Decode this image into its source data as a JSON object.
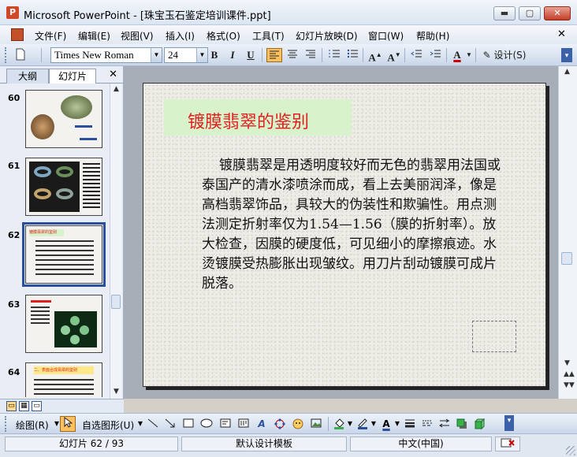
{
  "window": {
    "title": "Microsoft PowerPoint - [珠宝玉石鉴定培训课件.ppt]",
    "buttons": [
      "▬",
      "▢",
      "✕"
    ]
  },
  "menu": {
    "items": [
      "文件(F)",
      "编辑(E)",
      "视图(V)",
      "插入(I)",
      "格式(O)",
      "工具(T)",
      "幻灯片放映(D)",
      "窗口(W)",
      "帮助(H)"
    ],
    "close": "✕"
  },
  "toolbar": {
    "font": "Times New Roman",
    "size": "24",
    "bold": "B",
    "italic": "I",
    "underline": "U",
    "design_label": "设计(S)"
  },
  "panel": {
    "tabs": [
      "大纲",
      "幻灯片"
    ],
    "close": "✕",
    "slides": [
      {
        "num": "60"
      },
      {
        "num": "61"
      },
      {
        "num": "62",
        "thumb_title": "镀膜翡翠的鉴别"
      },
      {
        "num": "63"
      },
      {
        "num": "64",
        "thumb_title": "二、表面合成翡翠的鉴别"
      }
    ]
  },
  "slide": {
    "title": "镀膜翡翠的鉴别",
    "body": "镀膜翡翠是用透明度较好而无色的翡翠用法国或泰国产的清水漆喷涂而成，看上去美丽润泽，像是高档翡翠饰品，具较大的伪装性和欺骗性。用点测法测定折射率仅为1.54—1.56（膜的折射率）。放大检查，因膜的硬度低，可见细小的摩擦痕迹。水烫镀膜受热膨胀出现皱纹。用刀片刮动镀膜可成片脱落。"
  },
  "drawing": {
    "draw_label": "绘图(R)",
    "autoshapes_label": "自选图形(U)"
  },
  "status": {
    "slide_info": "幻灯片 62 / 93",
    "template": "默认设计模板",
    "language": "中文(中国)"
  },
  "colors": {
    "title_red": "#e02020",
    "title_box": "#d8f2cc",
    "selected_outline": "#2a4f9c"
  }
}
